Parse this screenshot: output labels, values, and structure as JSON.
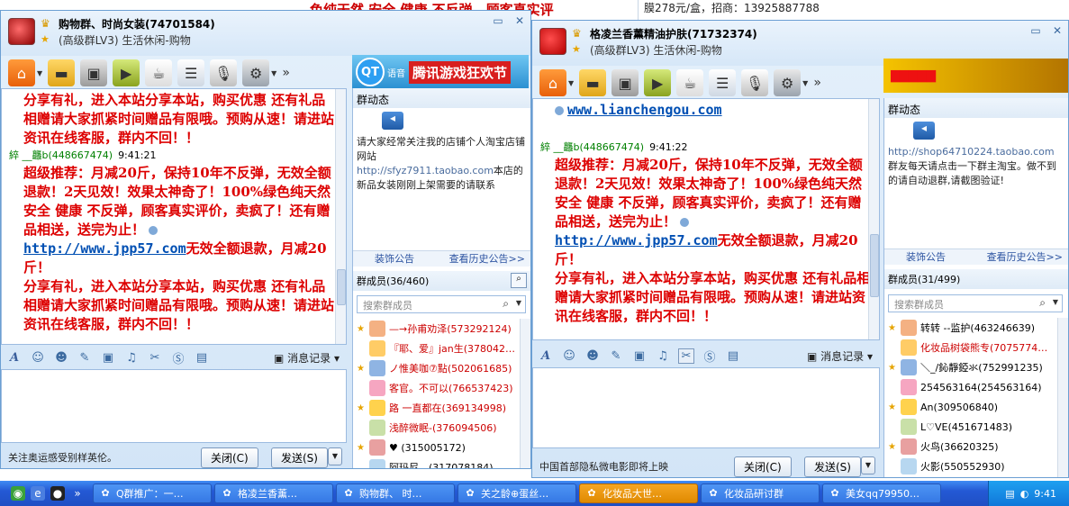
{
  "background": {
    "red_text": "色纯天然 安全 健康 不反弹，顾客真实评",
    "right_text": "膜278元/盒，招商：13925887788"
  },
  "windows": [
    {
      "group_name": "购物群、时尚女装(74701584)",
      "group_sub": "(高级群LV3) 生活休闲-购物",
      "ad_logo": "QT",
      "ad_sub": "语音",
      "ad_text": "腾讯游戏狂欢节",
      "messages": {
        "block1": "分享有礼，进入本站分享本站，购买优惠 还有礼品相赠请大家抓紧时间赠品有限哦。预购从速！请进站资讯在线客服，群内不回！！",
        "sender": "綷 __龘b(448667474)",
        "time": "9:41:21",
        "block2": "超级推荐：月减20斤，保持10年不反弹，无效全额退款！2天见效！效果太神奇了！100%绿色纯天然 安全 健康 不反弹，顾客真实评价，卖疯了！还有赠品相送，送完为止！",
        "link": "http://www.jpp57.com",
        "block3": "无效全额退款，月减20斤！",
        "block4": "分享有礼，进入本站分享本站，购买优惠 还有礼品相赠请大家抓紧时间赠品有限哦。预购从速！请进站资讯在线客服，群内不回！！"
      },
      "msg_log": "消息记录",
      "status": "关注奥运感受别样英伦。",
      "close_btn": "关闭(C)",
      "send_btn": "发送(S)",
      "notice_title": "群动态",
      "notice_text": "请大家经常关注我的店铺个人淘宝店铺网站",
      "notice_url": "http://sfyz7911.taobao.com",
      "notice_text2": "本店的新品女装刚刚上架需要的请联系",
      "link_decor": "装饰公告",
      "link_history": "查看历史公告>>",
      "members_title": "群成员(36/460)",
      "search_placeholder": "搜索群成员",
      "members": [
        {
          "name": "—→孙甫劝泽(573292124)",
          "color": "#cc0000"
        },
        {
          "name": "『耶、爱』jan生(378042…",
          "color": "#cc0000"
        },
        {
          "name": "ノ惟美咖⑦點(502061685)",
          "color": "#cc0000"
        },
        {
          "name": "客官。不可以(766537423)",
          "color": "#cc0000"
        },
        {
          "name": "路 一直都在(369134998)",
          "color": "#cc0000"
        },
        {
          "name": "浅醉微眠-(376094506)",
          "color": "#cc0000"
        },
        {
          "name": "♥ (315005172)",
          "color": "#000000"
        },
        {
          "name": "阿玛尼、(317078184)",
          "color": "#000000"
        }
      ]
    },
    {
      "group_name": "格凌兰香薰精油护肤(71732374)",
      "group_sub": "(高级群LV3) 生活休闲-购物",
      "messages": {
        "top_link": "www.lianchengou.com",
        "sender": "綷 __龘b(448667474)",
        "time": "9:41:22",
        "block2": "超级推荐：月减20斤，保持10年不反弹，无效全额退款！2天见效！效果太神奇了！100%绿色纯天然 安全 健康 不反弹，顾客真实评价，卖疯了！还有赠品相送，送完为止！",
        "link": "http://www.jpp57.com",
        "block3": "无效全额退款，月减20斤！",
        "block4": "分享有礼，进入本站分享本站，购买优惠 还有礼品相赠请大家抓紧时间赠品有限哦。预购从速！请进站资讯在线客服，群内不回！！"
      },
      "msg_log": "消息记录",
      "status": "中国首部隐私微电影即将上映",
      "close_btn": "关闭(C)",
      "send_btn": "发送(S)",
      "notice_title": "群动态",
      "notice_url": "http://shop64710224.taobao.com",
      "notice_text2": "群友每天请点击一下群主淘宝。做不到的请自动退群,请截图验证!",
      "link_decor": "装饰公告",
      "link_history": "查看历史公告>>",
      "members_title": "群成员(31/499)",
      "search_placeholder": "搜索群成员",
      "members": [
        {
          "name": "转转 --监护(463246639)",
          "color": "#000000"
        },
        {
          "name": "化妆品树袋熊专(7075774…",
          "color": "#cc0000"
        },
        {
          "name": "＼_/鈊靜錏氺(752991235)",
          "color": "#000000"
        },
        {
          "name": "254563164(254563164)",
          "color": "#000000"
        },
        {
          "name": "An(309506840)",
          "color": "#000000"
        },
        {
          "name": "L♡VE(451671483)",
          "color": "#000000"
        },
        {
          "name": "火鸟(36620325)",
          "color": "#000000"
        },
        {
          "name": "火影(550552930)",
          "color": "#000000"
        }
      ]
    }
  ],
  "taskbar": {
    "tasks": [
      {
        "label": "Q群推广：一…",
        "active": false
      },
      {
        "label": "格凌兰香薰…",
        "active": false
      },
      {
        "label": "购物群、 时…",
        "active": false
      },
      {
        "label": "关之龄⊕蛋丝…",
        "active": false
      },
      {
        "label": "化妆品大世…",
        "active": true
      },
      {
        "label": "化妆品研讨群",
        "active": false
      },
      {
        "label": "美女qq79950…",
        "active": false
      }
    ],
    "clock": "9:41"
  },
  "colors": {
    "accent": "#dd0000",
    "link": "#004fb3",
    "taskbar": "#2459d4",
    "active_task": "#e08a00"
  }
}
